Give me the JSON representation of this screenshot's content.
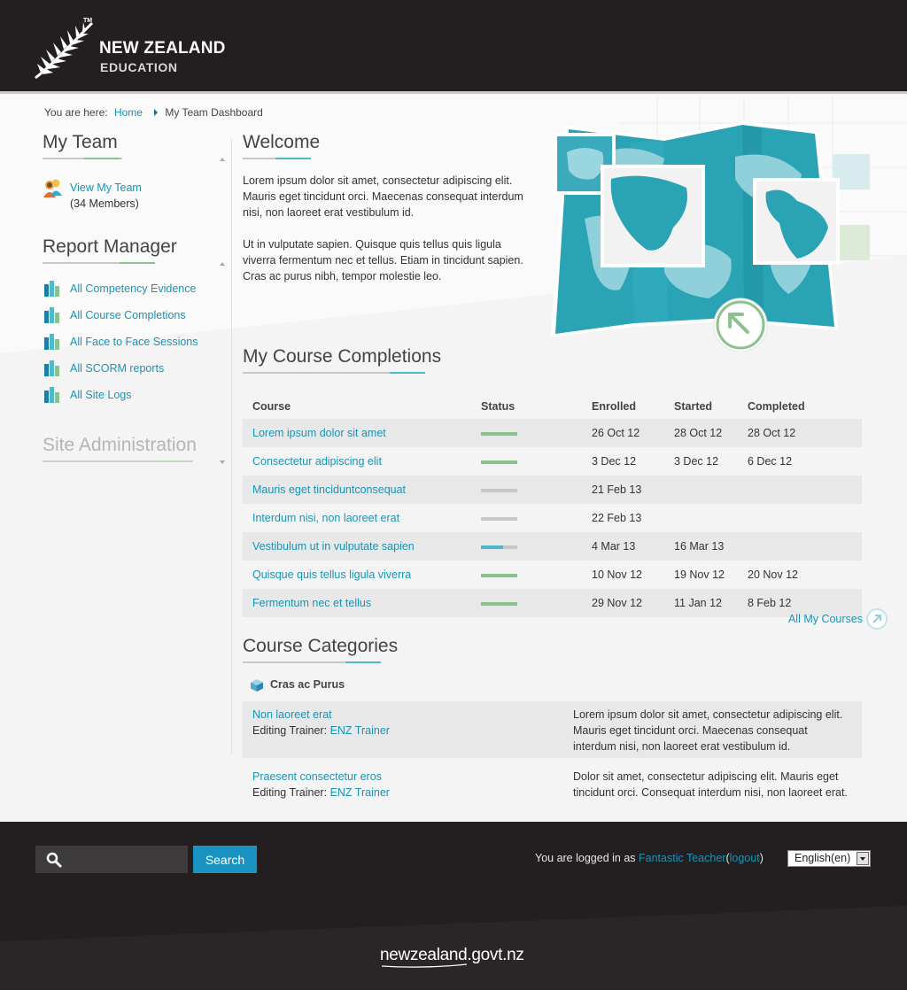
{
  "header": {
    "logo_line1": "NEW ZEALAND",
    "logo_line2": "EDUCATION",
    "logo_tm": "TM"
  },
  "breadcrumb": {
    "prefix": "You are here:",
    "home": "Home",
    "current": "My Team Dashboard"
  },
  "sidebar": {
    "my_team_title": "My Team",
    "view_team": "View My Team",
    "member_count": "(34 Members)",
    "report_title": "Report Manager",
    "reports": [
      "All Competency Evidence",
      "All Course Completions",
      "All Face to Face Sessions",
      "All SCORM reports",
      "All Site Logs"
    ],
    "site_admin_title": "Site Administration"
  },
  "welcome": {
    "title": "Welcome",
    "para1": "Lorem ipsum dolor sit amet, consectetur adipiscing elit. Mauris eget tincidunt orci. Maecenas consequat interdum nisi, non laoreet erat vestibulum id.",
    "para2": "Ut in vulputate sapien. Quisque quis tellus quis ligula viverra fermentum nec et tellus. Etiam in tincidunt sapien. Cras ac purus nibh, tempor molestie leo."
  },
  "completions": {
    "title": "My Course Completions",
    "headers": [
      "Course",
      "Status",
      "Enrolled",
      "Started",
      "Completed"
    ],
    "rows": [
      {
        "course": "Lorem ipsum dolor sit amet",
        "progress": 1.0,
        "enrolled": "26 Oct 12",
        "started": "28 Oct 12",
        "completed": "28 Oct 12"
      },
      {
        "course": "Consectetur adipiscing elit",
        "progress": 1.0,
        "enrolled": "3 Dec 12",
        "started": "3 Dec 12",
        "completed": "6 Dec 12"
      },
      {
        "course": "Mauris eget tinciduntconsequat",
        "progress": 0,
        "enrolled": "21 Feb 13",
        "started": "",
        "completed": ""
      },
      {
        "course": "Interdum nisi, non laoreet erat",
        "progress": 0,
        "enrolled": "22 Feb 13",
        "started": "",
        "completed": ""
      },
      {
        "course": "Vestibulum ut in vulputate sapien",
        "progress": 0.6,
        "enrolled": "4 Mar 13",
        "started": "16 Mar 13",
        "completed": ""
      },
      {
        "course": "Quisque quis tellus ligula viverra",
        "progress": 1.0,
        "enrolled": "10 Nov 12",
        "started": "19 Nov 12",
        "completed": "20 Nov 12"
      },
      {
        "course": "Fermentum nec et tellus",
        "progress": 1.0,
        "enrolled": "29 Nov 12",
        "started": "11 Jan 12",
        "completed": "8 Feb 12"
      }
    ],
    "all_link": "All My Courses"
  },
  "categories": {
    "title": "Course Categories",
    "group": "Cras ac Purus",
    "items": [
      {
        "name": "Non laoreet erat",
        "trainer_label": "Editing Trainer:",
        "trainer": "ENZ Trainer",
        "desc": "Lorem ipsum dolor sit amet, consectetur adipiscing elit. Mauris eget tincidunt orci. Maecenas consequat interdum nisi, non laoreet erat vestibulum id."
      },
      {
        "name": "Praesent consectetur eros",
        "trainer_label": "Editing Trainer:",
        "trainer": "ENZ Trainer",
        "desc": "Dolor sit amet, consectetur adipiscing elit. Mauris eget tincidunt orci. Consequat interdum nisi, non laoreet erat."
      }
    ]
  },
  "footer": {
    "search_button": "Search",
    "logged_prefix": "You are logged in as",
    "user": "Fantastic Teacher",
    "logout": "logout",
    "language": "English(en)",
    "govt": "newzealand.govt.nz"
  },
  "colors": {
    "header_bg": "#231f20",
    "accent_blue": "#1b93b5",
    "complete_green": "#8bc18b",
    "partial_teal": "#4fb8cc",
    "empty_gray": "#c8c8c8"
  }
}
